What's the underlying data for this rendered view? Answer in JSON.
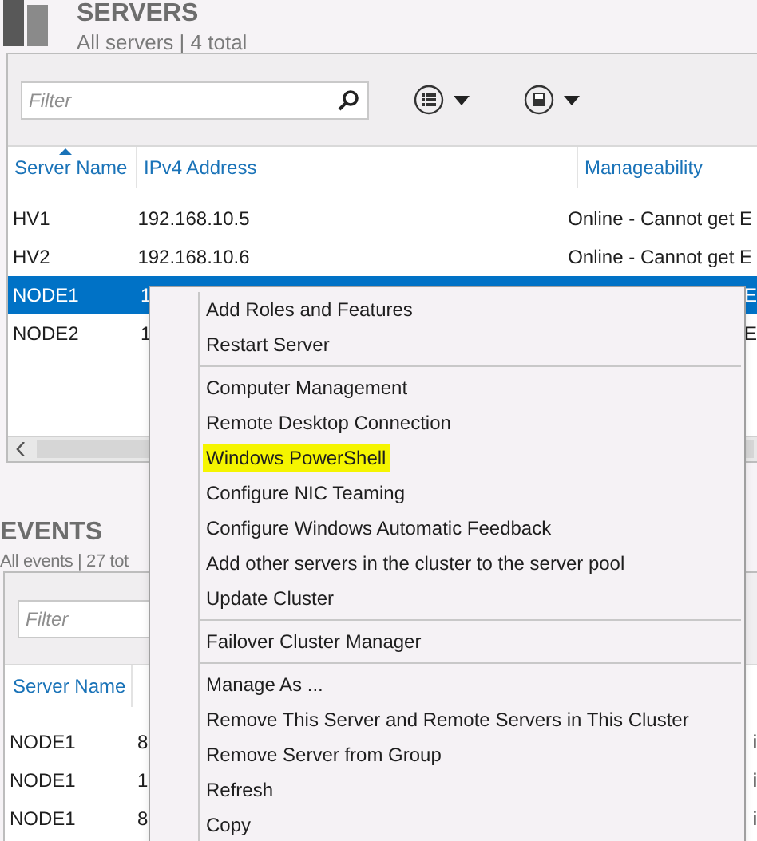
{
  "servers_header": {
    "title": "SERVERS",
    "subtitle": "All servers | 4 total"
  },
  "servers_panel": {
    "filter": {
      "placeholder": "Filter"
    },
    "columns": [
      "Server Name",
      "IPv4 Address",
      "Manageability"
    ],
    "rows": [
      {
        "cells": [
          "HV1",
          "192.168.10.5",
          "Online - Cannot get E"
        ],
        "selected": false,
        "partly_covered": false
      },
      {
        "cells": [
          "HV2",
          "192.168.10.6",
          "Online - Cannot get E"
        ],
        "selected": false,
        "partly_covered": false
      },
      {
        "cells": [
          "NODE1",
          "1",
          "E"
        ],
        "selected": true,
        "partly_covered": true
      },
      {
        "cells": [
          "NODE2",
          "1",
          "E"
        ],
        "selected": false,
        "partly_covered": true
      }
    ]
  },
  "events_header": {
    "title": "EVENTS",
    "subtitle": "All events | 27 tot"
  },
  "events_panel": {
    "filter": {
      "placeholder": "Filter"
    },
    "columns": [
      "Server Name"
    ],
    "rows": [
      {
        "cells": [
          "NODE1",
          "8",
          "i"
        ]
      },
      {
        "cells": [
          "NODE1",
          "1",
          "i"
        ]
      },
      {
        "cells": [
          "NODE1",
          "8",
          "i"
        ]
      }
    ]
  },
  "context_menu": {
    "items": [
      {
        "kind": "item",
        "label": "Add Roles and Features",
        "highlighted": false
      },
      {
        "kind": "item",
        "label": "Restart Server",
        "highlighted": false
      },
      {
        "kind": "separator"
      },
      {
        "kind": "item",
        "label": "Computer Management",
        "highlighted": false
      },
      {
        "kind": "item",
        "label": "Remote Desktop Connection",
        "highlighted": false
      },
      {
        "kind": "item",
        "label": "Windows PowerShell",
        "highlighted": true
      },
      {
        "kind": "item",
        "label": "Configure NIC Teaming",
        "highlighted": false
      },
      {
        "kind": "item",
        "label": "Configure Windows Automatic Feedback",
        "highlighted": false
      },
      {
        "kind": "item",
        "label": "Add other servers in the cluster to the server pool",
        "highlighted": false
      },
      {
        "kind": "item",
        "label": "Update Cluster",
        "highlighted": false
      },
      {
        "kind": "separator"
      },
      {
        "kind": "item",
        "label": "Failover Cluster Manager",
        "highlighted": false
      },
      {
        "kind": "separator"
      },
      {
        "kind": "item",
        "label": "Manage As ...",
        "highlighted": false
      },
      {
        "kind": "item",
        "label": "Remove This Server and Remote Servers in This Cluster",
        "highlighted": false
      },
      {
        "kind": "item",
        "label": "Remove Server from Group",
        "highlighted": false
      },
      {
        "kind": "item",
        "label": "Refresh",
        "highlighted": false
      },
      {
        "kind": "item",
        "label": "Copy",
        "highlighted": false
      }
    ]
  }
}
